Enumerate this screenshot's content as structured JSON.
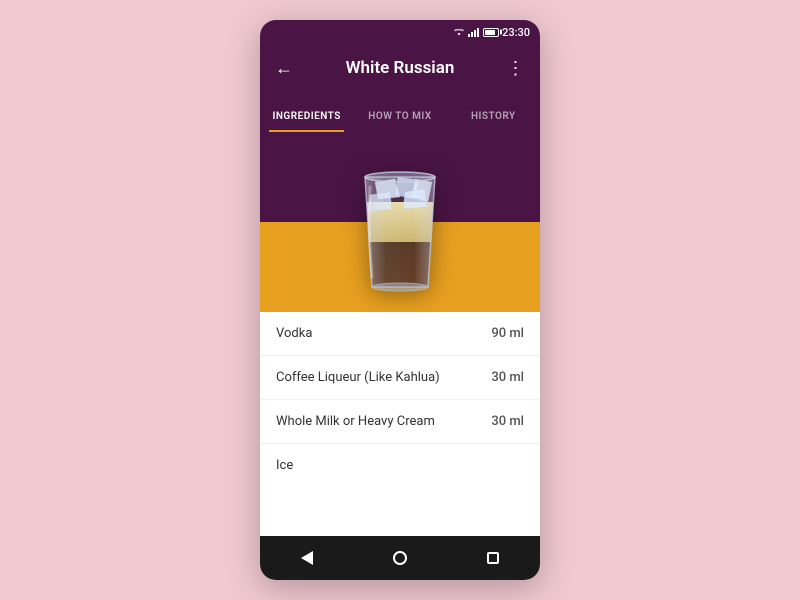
{
  "statusBar": {
    "time": "23:30"
  },
  "header": {
    "title": "White Russian",
    "backLabel": "←",
    "menuLabel": "⋮"
  },
  "tabs": [
    {
      "id": "ingredients",
      "label": "INGREDIENTS",
      "active": true
    },
    {
      "id": "howto",
      "label": "HOW TO MIX",
      "active": false
    },
    {
      "id": "history",
      "label": "HISTORY",
      "active": false
    }
  ],
  "ingredients": [
    {
      "name": "Vodka",
      "amount": "90 ml"
    },
    {
      "name": "Coffee Liqueur (Like Kahlua)",
      "amount": "30 ml"
    },
    {
      "name": "Whole Milk or Heavy Cream",
      "amount": "30 ml"
    },
    {
      "name": "Ice",
      "amount": ""
    }
  ],
  "colors": {
    "headerBg": "#4a1545",
    "imageBgTop": "#4a1545",
    "imageBgBottom": "#e8a020",
    "activeTab": "#e8a020",
    "navBar": "#1a1a1a"
  }
}
